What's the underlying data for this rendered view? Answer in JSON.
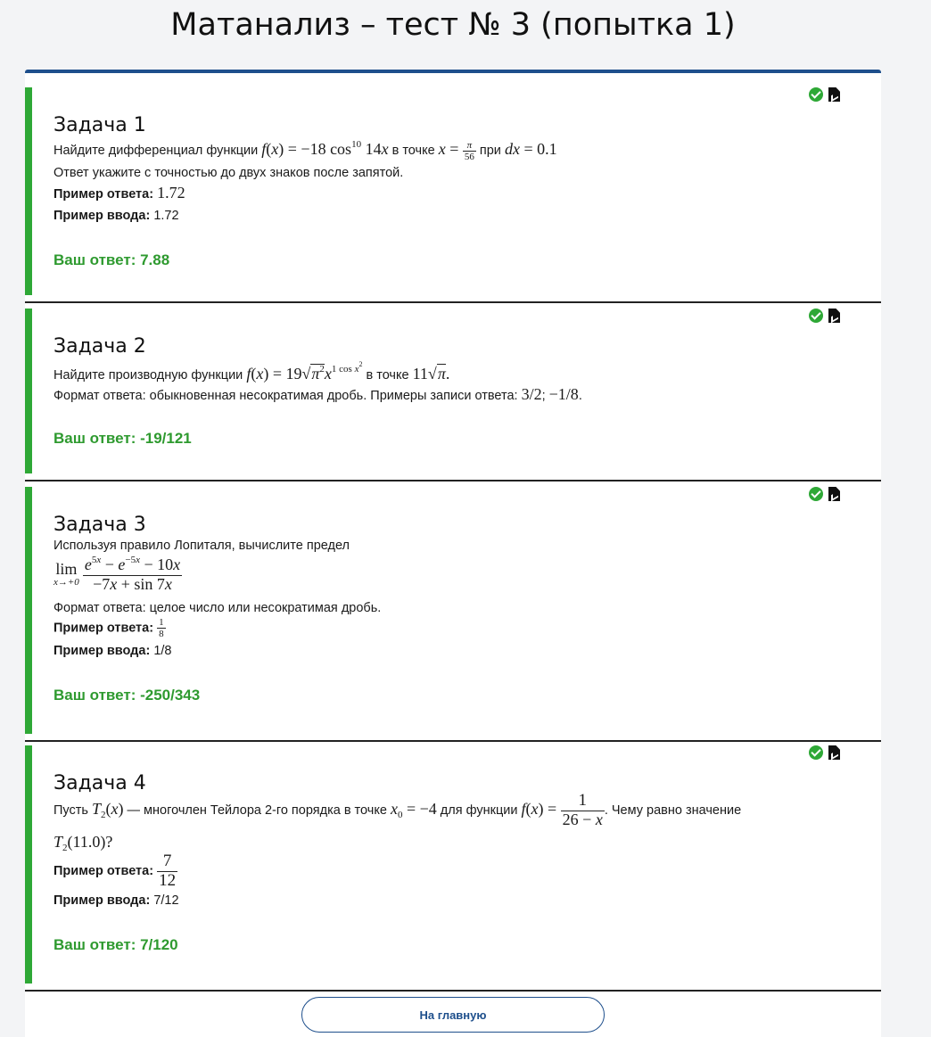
{
  "page": {
    "title": "Матанализ – тест № 3 (попытка 1)"
  },
  "labels": {
    "example_answer": "Пример ответа:",
    "example_input": "Пример ввода:"
  },
  "tasks": [
    {
      "title": "Задача 1",
      "text_a": "Найдите дифференциал функции ",
      "text_b": " в точке ",
      "text_c": " при ",
      "instruction": "Ответ укажите с точностью до двух знаков после запятой.",
      "example_answer": "1.72",
      "example_input": "1.72",
      "your_answer": "Ваш ответ: 7.88",
      "status": "correct"
    },
    {
      "title": "Задача 2",
      "text_a": "Найдите производную функции ",
      "text_b": " в точке ",
      "format": "Формат ответа: обыкновенная несократимая дробь. Примеры записи ответа: ",
      "your_answer": "Ваш ответ: -19/121",
      "status": "correct"
    },
    {
      "title": "Задача 3",
      "text_a": "Используя правило Лопиталя, вычислите предел",
      "format": "Формат ответа: целое число или несократимая дробь.",
      "example_input": "1/8",
      "your_answer": "Ваш ответ: -250/343",
      "status": "correct"
    },
    {
      "title": "Задача 4",
      "text_a": "Пусть ",
      "text_b": " — многочлен Тейлора 2-го порядка в точке ",
      "text_c": " для функции ",
      "text_d": ". Чему равно значение",
      "example_input": "7/12",
      "your_answer": "Ваш ответ: 7/120",
      "status": "correct"
    }
  ],
  "icons": {
    "status": "check-circle-icon",
    "document": "file-document-icon"
  },
  "colors": {
    "accent": "#1e4f8c",
    "success": "#2ea836"
  },
  "footer": {
    "home_button": "На главную"
  }
}
